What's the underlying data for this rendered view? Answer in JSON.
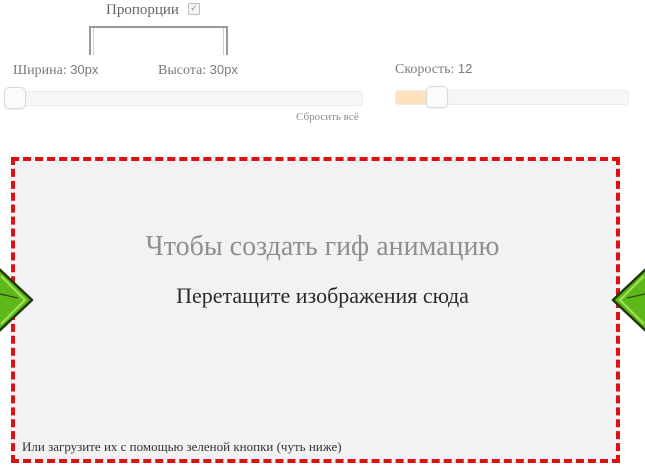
{
  "proportions": {
    "label": "Пропорции",
    "checked": true,
    "check_glyph": "✓"
  },
  "width": {
    "label": "Ширина:",
    "value": "30px"
  },
  "height": {
    "label": "Высота:",
    "value": "30px"
  },
  "speed": {
    "label": "Скорость:",
    "value": "12",
    "fill_fraction": 0.18
  },
  "size_slider": {
    "fraction": 0.0
  },
  "reset": {
    "label": "Сбросить всё"
  },
  "drop_zone": {
    "title": "Чтобы создать гиф анимацию",
    "subtitle": "Перетащите изображения сюда",
    "hint": "Или загрузите их с помощью зеленой кнопки (чуть ниже)"
  },
  "colors": {
    "border": "#dd1111",
    "accent_fill": "#fde3bd",
    "arrow_green": "#5fb81a"
  },
  "icons": {
    "left": "green-arrow-left-icon",
    "right": "green-arrow-right-icon"
  }
}
